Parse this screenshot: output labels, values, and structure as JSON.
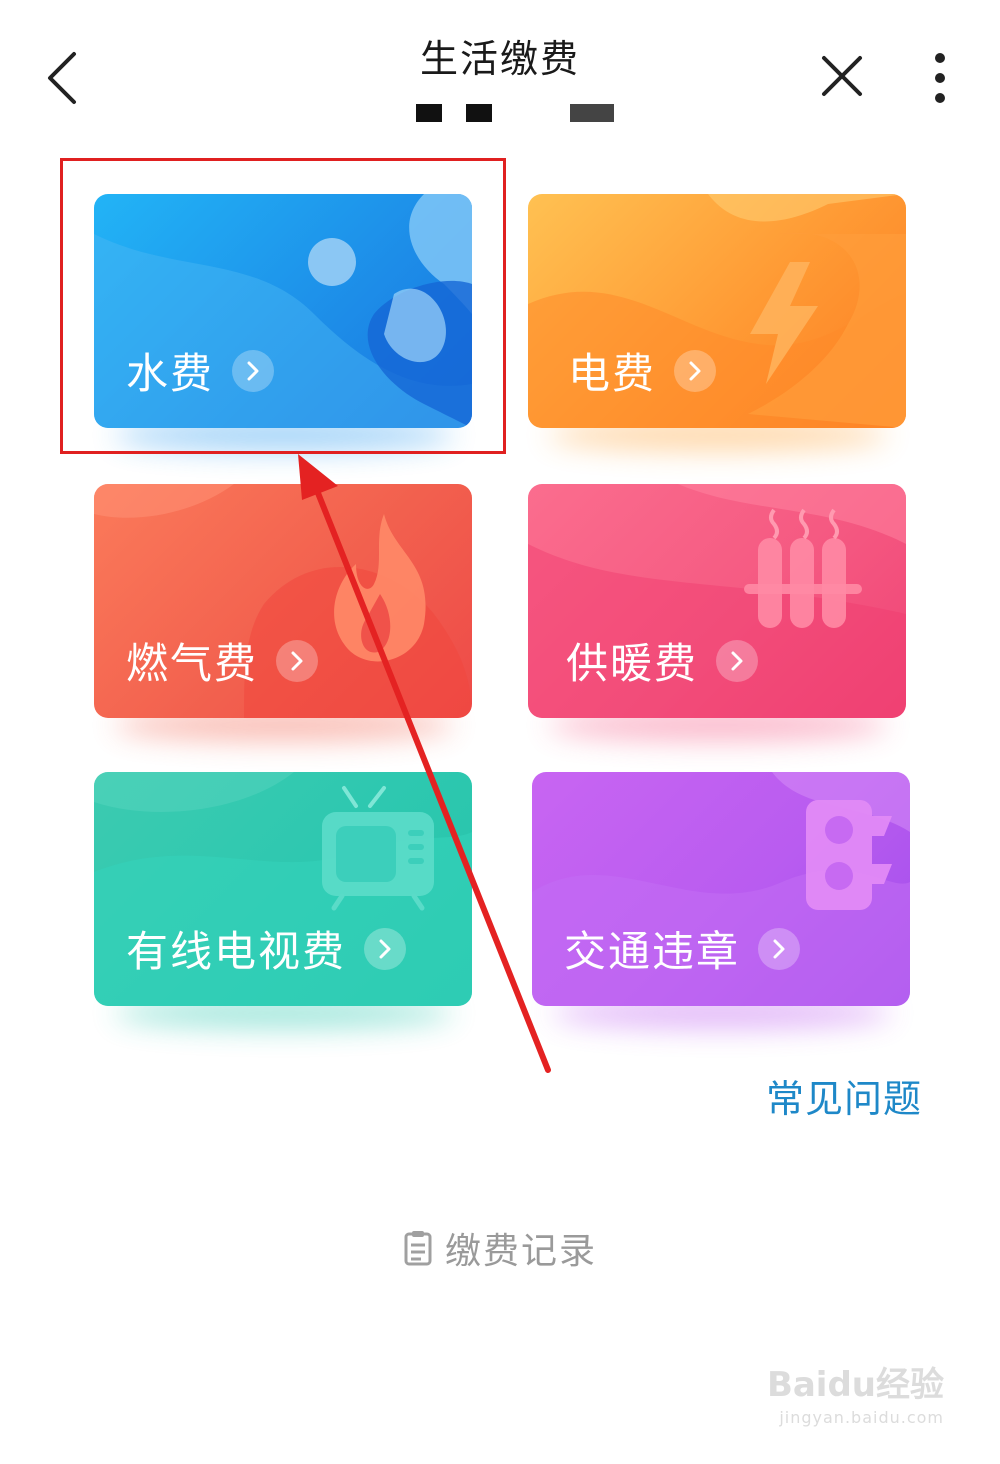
{
  "header": {
    "title": "生活缴费"
  },
  "cards": [
    {
      "label": "水费",
      "icon": "water-drop-icon"
    },
    {
      "label": "电费",
      "icon": "lightning-icon"
    },
    {
      "label": "燃气费",
      "icon": "flame-icon"
    },
    {
      "label": "供暖费",
      "icon": "radiator-icon"
    },
    {
      "label": "有线电视费",
      "icon": "tv-icon"
    },
    {
      "label": "交通违章",
      "icon": "traffic-light-icon"
    }
  ],
  "links": {
    "faq": "常见问题",
    "records": "缴费记录"
  },
  "watermark": {
    "brand": "Baidu经验",
    "url": "jingyan.baidu.com"
  },
  "colors": {
    "water": "#2a9af0",
    "electricity": "#ffa43a",
    "gas": "#f26450",
    "heating": "#f55a86",
    "cable_tv": "#2ec8b0",
    "traffic": "#bd5cf0",
    "highlight": "#e02020",
    "faq_link": "#1e88c8"
  }
}
